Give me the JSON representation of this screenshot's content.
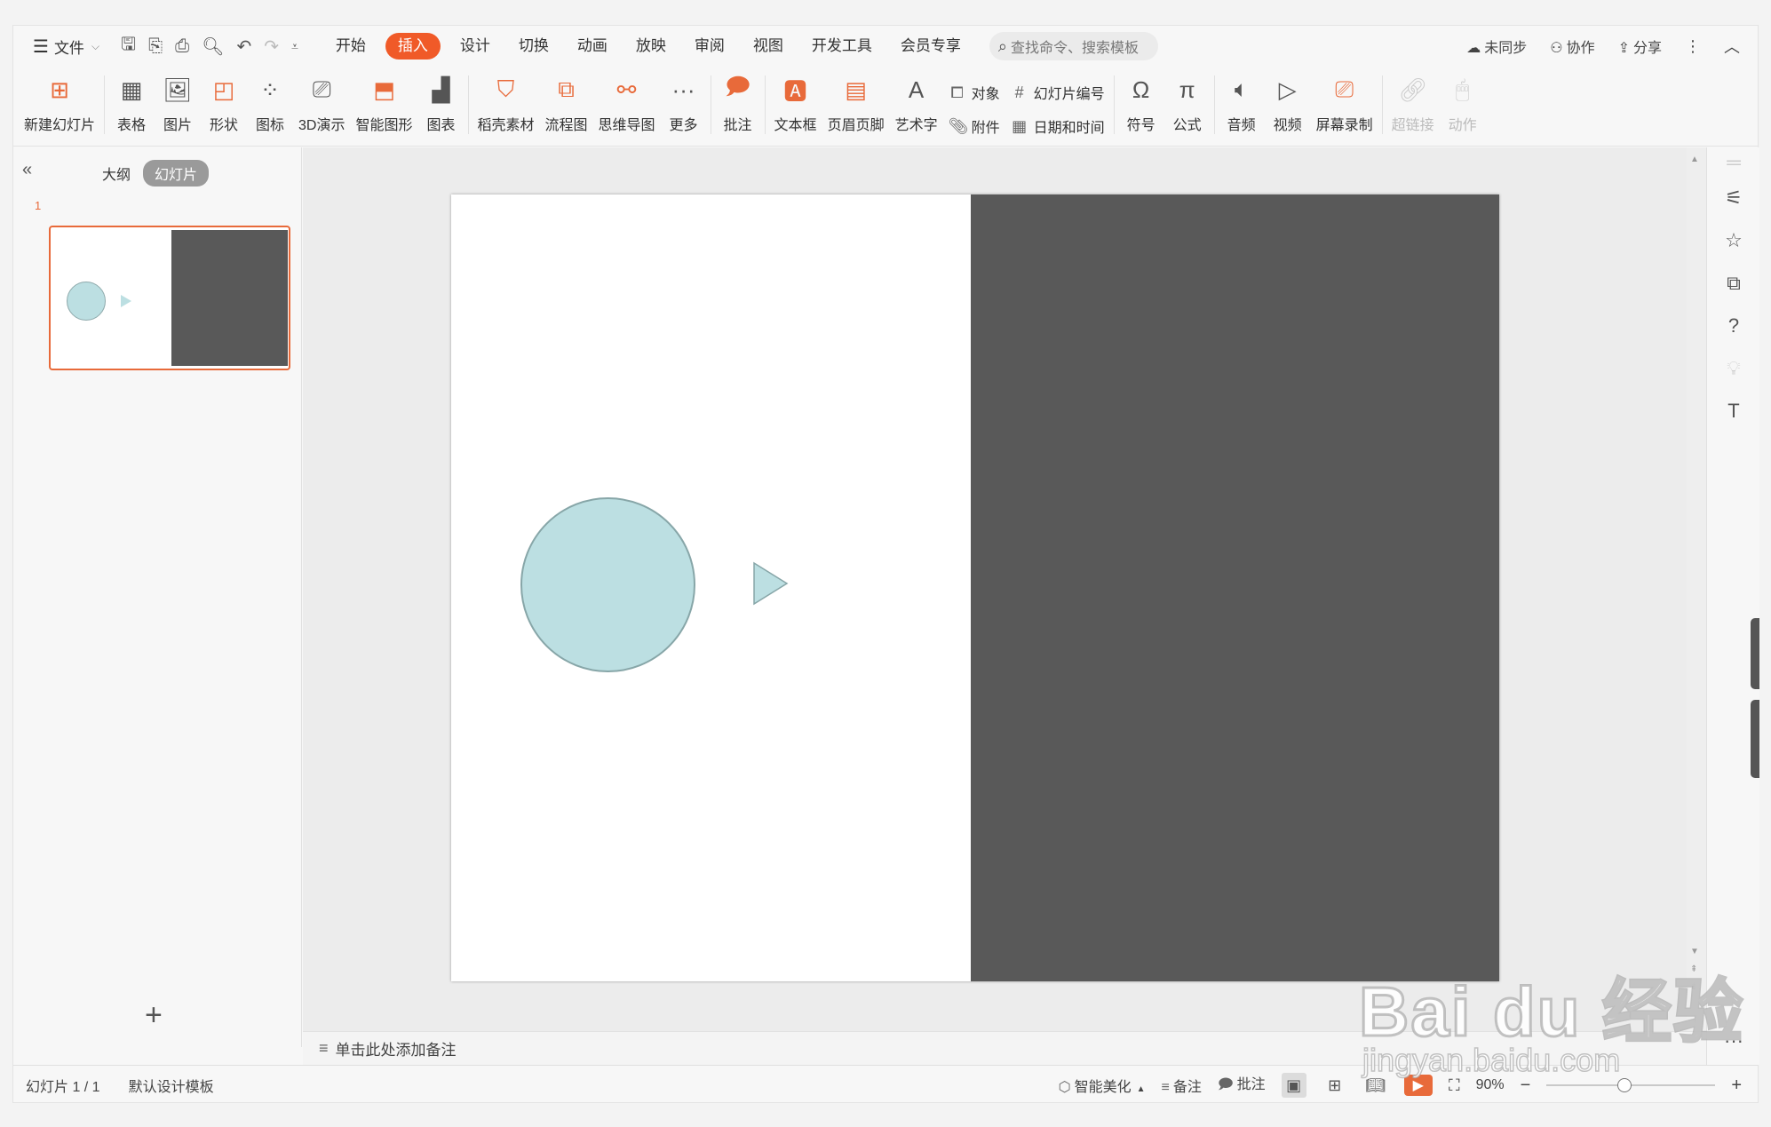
{
  "menubar": {
    "file_label": "文件",
    "tabs": [
      "开始",
      "插入",
      "设计",
      "切换",
      "动画",
      "放映",
      "审阅",
      "视图",
      "开发工具",
      "会员专享"
    ],
    "active_tab": "插入",
    "search_placeholder": "查找命令、搜索模板",
    "sync_label": "未同步",
    "collab_label": "协作",
    "share_label": "分享"
  },
  "ribbon": {
    "new_slide": "新建幻灯片",
    "table": "表格",
    "picture": "图片",
    "shape": "形状",
    "icon": "图标",
    "demo3d": "3D演示",
    "smartart": "智能图形",
    "chart": "图表",
    "material": "稻壳素材",
    "flowchart": "流程图",
    "mindmap": "思维导图",
    "more": "更多",
    "comment": "批注",
    "textbox": "文本框",
    "header_footer": "页眉页脚",
    "wordart": "艺术字",
    "object": "对象",
    "attachment": "附件",
    "slide_number": "幻灯片编号",
    "date_time": "日期和时间",
    "symbol": "符号",
    "formula": "公式",
    "audio": "音频",
    "video": "视频",
    "screen_record": "屏幕录制",
    "hyperlink": "超链接",
    "action": "动作"
  },
  "leftpanel": {
    "outline_tab": "大纲",
    "slides_tab": "幻灯片",
    "slide_number": "1"
  },
  "notes": {
    "placeholder": "单击此处添加备注"
  },
  "statusbar": {
    "slide_counter": "幻灯片 1 / 1",
    "template": "默认设计模板",
    "beautify": "智能美化",
    "notes": "备注",
    "comments": "批注",
    "zoom": "90%"
  },
  "watermark": {
    "logo": "Bai du 经验",
    "url": "jingyan.baidu.com"
  },
  "colors": {
    "accent": "#f05a28",
    "circle_fill": "#bcdfe2",
    "dark_panel": "#595959"
  }
}
